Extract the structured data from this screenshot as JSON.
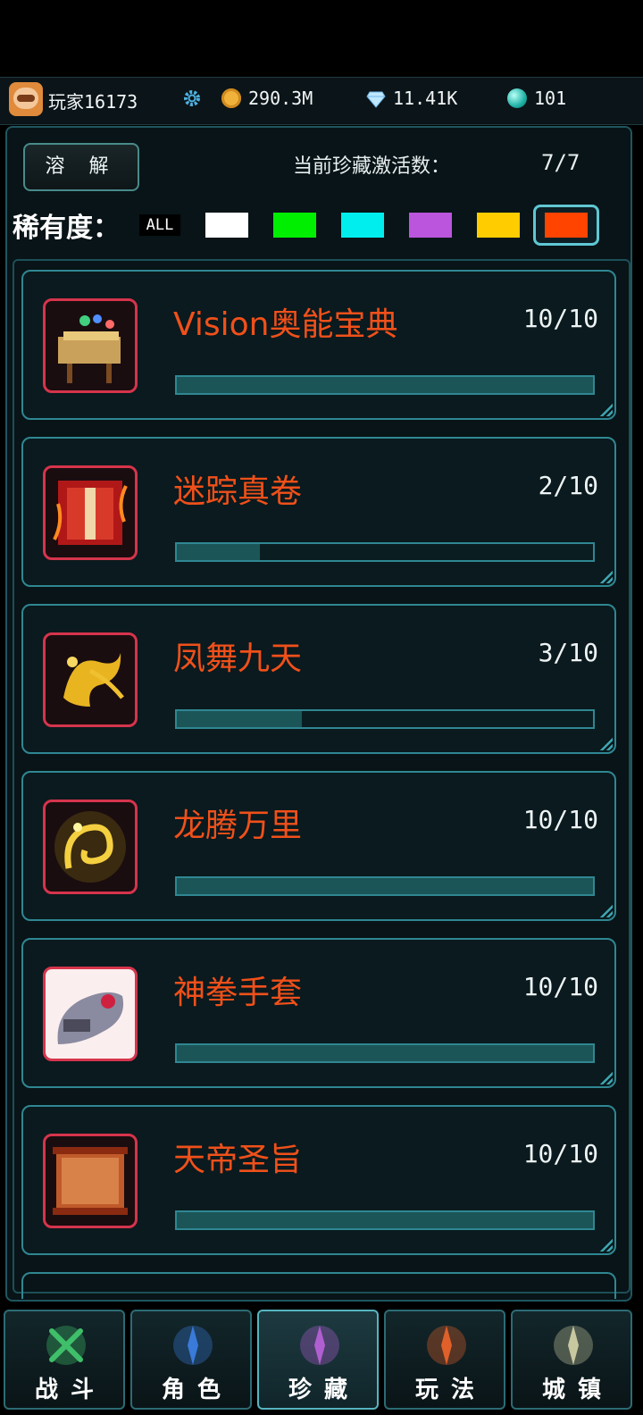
{
  "topbar": {
    "player_name": "玩家16173",
    "gold": "290.3M",
    "diamonds": "11.41K",
    "orbs": "101",
    "icons": [
      "avatar",
      "gear-icon",
      "coin-icon",
      "diamond-icon",
      "orb-icon"
    ]
  },
  "header": {
    "dissolve_label": "溶 解",
    "active_label": "当前珍藏激活数：",
    "active_value": "7/7"
  },
  "rarity": {
    "label": "稀有度：",
    "all_label": "ALL",
    "colors": [
      "#ffffff",
      "#00ee00",
      "#00eeee",
      "#bb55dd",
      "#ffcc00",
      "#ff4400"
    ],
    "selected": "#ff4400"
  },
  "items": [
    {
      "name": "Vision奥能宝典",
      "count": "10/10",
      "progress": 1.0,
      "icon": "book-icon"
    },
    {
      "name": "迷踪真卷",
      "count": "2/10",
      "progress": 0.2,
      "icon": "scroll-icon"
    },
    {
      "name": "凤舞九天",
      "count": "3/10",
      "progress": 0.3,
      "icon": "phoenix-icon"
    },
    {
      "name": "龙腾万里",
      "count": "10/10",
      "progress": 1.0,
      "icon": "dragon-icon"
    },
    {
      "name": "神拳手套",
      "count": "10/10",
      "progress": 1.0,
      "icon": "gauntlet-icon"
    },
    {
      "name": "天帝圣旨",
      "count": "10/10",
      "progress": 1.0,
      "icon": "edict-icon"
    }
  ],
  "nav": [
    {
      "label": "战斗",
      "icon": "swords-icon",
      "color": "#3fbf6a"
    },
    {
      "label": "角色",
      "icon": "sword-icon",
      "color": "#3a7ad8"
    },
    {
      "label": "珍藏",
      "icon": "feather-icon",
      "color": "#b05fd0"
    },
    {
      "label": "玩法",
      "icon": "flame-icon",
      "color": "#e0602a"
    },
    {
      "label": "城镇",
      "icon": "emblem-icon",
      "color": "#c8c8a0"
    }
  ]
}
